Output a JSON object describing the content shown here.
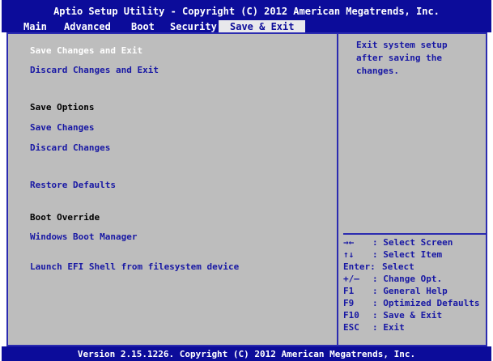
{
  "header": {
    "title": "Aptio Setup Utility - Copyright (C) 2012 American Megatrends, Inc."
  },
  "tabs": [
    {
      "label": "Main"
    },
    {
      "label": "Advanced"
    },
    {
      "label": "Boot"
    },
    {
      "label": "Security"
    },
    {
      "label": "Save & Exit"
    }
  ],
  "active_tab": "Save & Exit",
  "menu": {
    "save_changes_and_exit": "Save Changes and Exit",
    "discard_changes_and_exit": "Discard Changes and Exit",
    "save_options_header": "Save Options",
    "save_changes": "Save Changes",
    "discard_changes": "Discard Changes",
    "restore_defaults": "Restore Defaults",
    "boot_override_header": "Boot Override",
    "windows_boot_manager": "Windows Boot Manager",
    "launch_efi_shell": "Launch EFI Shell from filesystem device"
  },
  "help": {
    "lines": [
      "Exit system setup",
      "after saving the",
      "changes."
    ]
  },
  "keys": [
    {
      "key": "→←",
      "desc": ": Select Screen"
    },
    {
      "key": "↑↓",
      "desc": ": Select Item"
    },
    {
      "key": "Enter:",
      "desc": "Select"
    },
    {
      "key": "+/—",
      "desc": ": Change Opt."
    },
    {
      "key": "F1",
      "desc": ": General Help"
    },
    {
      "key": "F9",
      "desc": ": Optimized Defaults"
    },
    {
      "key": "F10",
      "desc": ": Save & Exit"
    },
    {
      "key": "ESC",
      "desc": ": Exit"
    }
  ],
  "footer": {
    "text": "Version 2.15.1226. Copyright (C) 2012 American Megatrends, Inc."
  },
  "colors": {
    "title_bg": "#0c0c9a",
    "panel_bg": "#bdbdbd",
    "item_text": "#1818a4",
    "selected_text": "#ffffff"
  }
}
